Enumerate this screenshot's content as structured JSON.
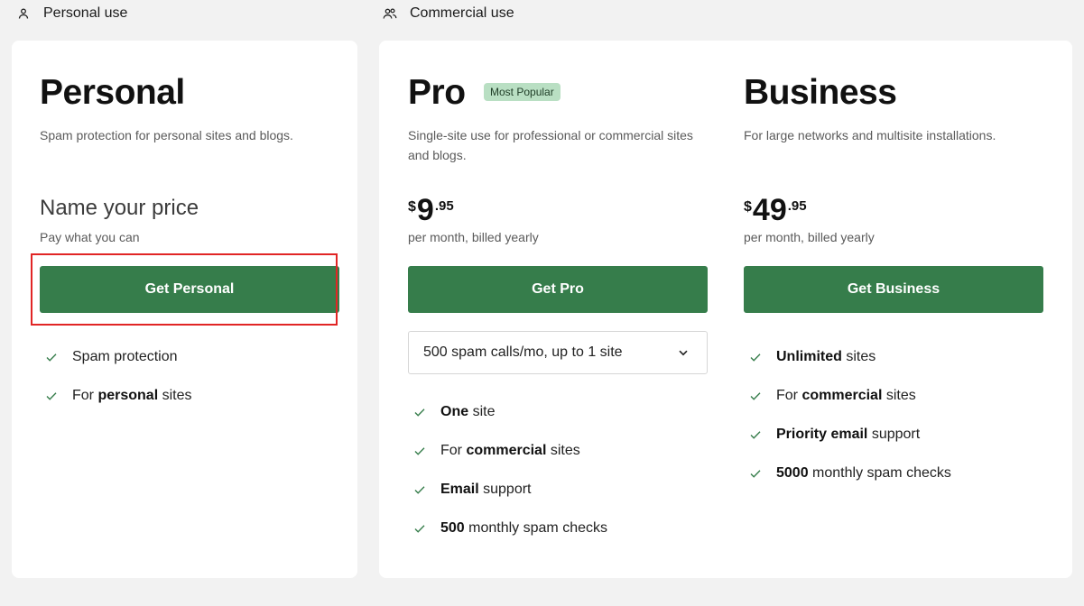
{
  "sections": {
    "personal": {
      "label": "Personal use",
      "icon": "person-icon"
    },
    "commercial": {
      "label": "Commercial use",
      "icon": "people-icon"
    }
  },
  "colors": {
    "button": "#367d4b",
    "badge_bg": "#b9dfc3",
    "highlight": "#e12525",
    "check": "#367d4b"
  },
  "plans": {
    "personal": {
      "name": "Personal",
      "description": "Spam protection for personal sites and blogs.",
      "price_heading": "Name your price",
      "price_sub": "Pay what you can",
      "button": "Get Personal",
      "features": [
        {
          "pre": "Spam protection",
          "bold": "",
          "post": ""
        },
        {
          "pre": "For ",
          "bold": "personal",
          "post": " sites"
        }
      ]
    },
    "pro": {
      "name": "Pro",
      "badge": "Most Popular",
      "description": "Single-site use for professional or commercial sites and blogs.",
      "currency": "$",
      "price_int": "9",
      "price_dec": ".95",
      "price_sub": "per month, billed yearly",
      "button": "Get Pro",
      "select_value": "500 spam calls/mo, up to 1 site",
      "features": [
        {
          "pre": "",
          "bold": "One",
          "post": " site"
        },
        {
          "pre": "For ",
          "bold": "commercial",
          "post": " sites"
        },
        {
          "pre": "",
          "bold": "Email",
          "post": " support"
        },
        {
          "pre": "",
          "bold": "500",
          "post": " monthly spam checks"
        }
      ]
    },
    "business": {
      "name": "Business",
      "description": "For large networks and multisite installations.",
      "currency": "$",
      "price_int": "49",
      "price_dec": ".95",
      "price_sub": "per month, billed yearly",
      "button": "Get Business",
      "features": [
        {
          "pre": "",
          "bold": "Unlimited",
          "post": " sites"
        },
        {
          "pre": "For ",
          "bold": "commercial",
          "post": " sites"
        },
        {
          "pre": "",
          "bold": "Priority email",
          "post": " support"
        },
        {
          "pre": "",
          "bold": "5000",
          "post": " monthly spam checks"
        }
      ]
    }
  }
}
